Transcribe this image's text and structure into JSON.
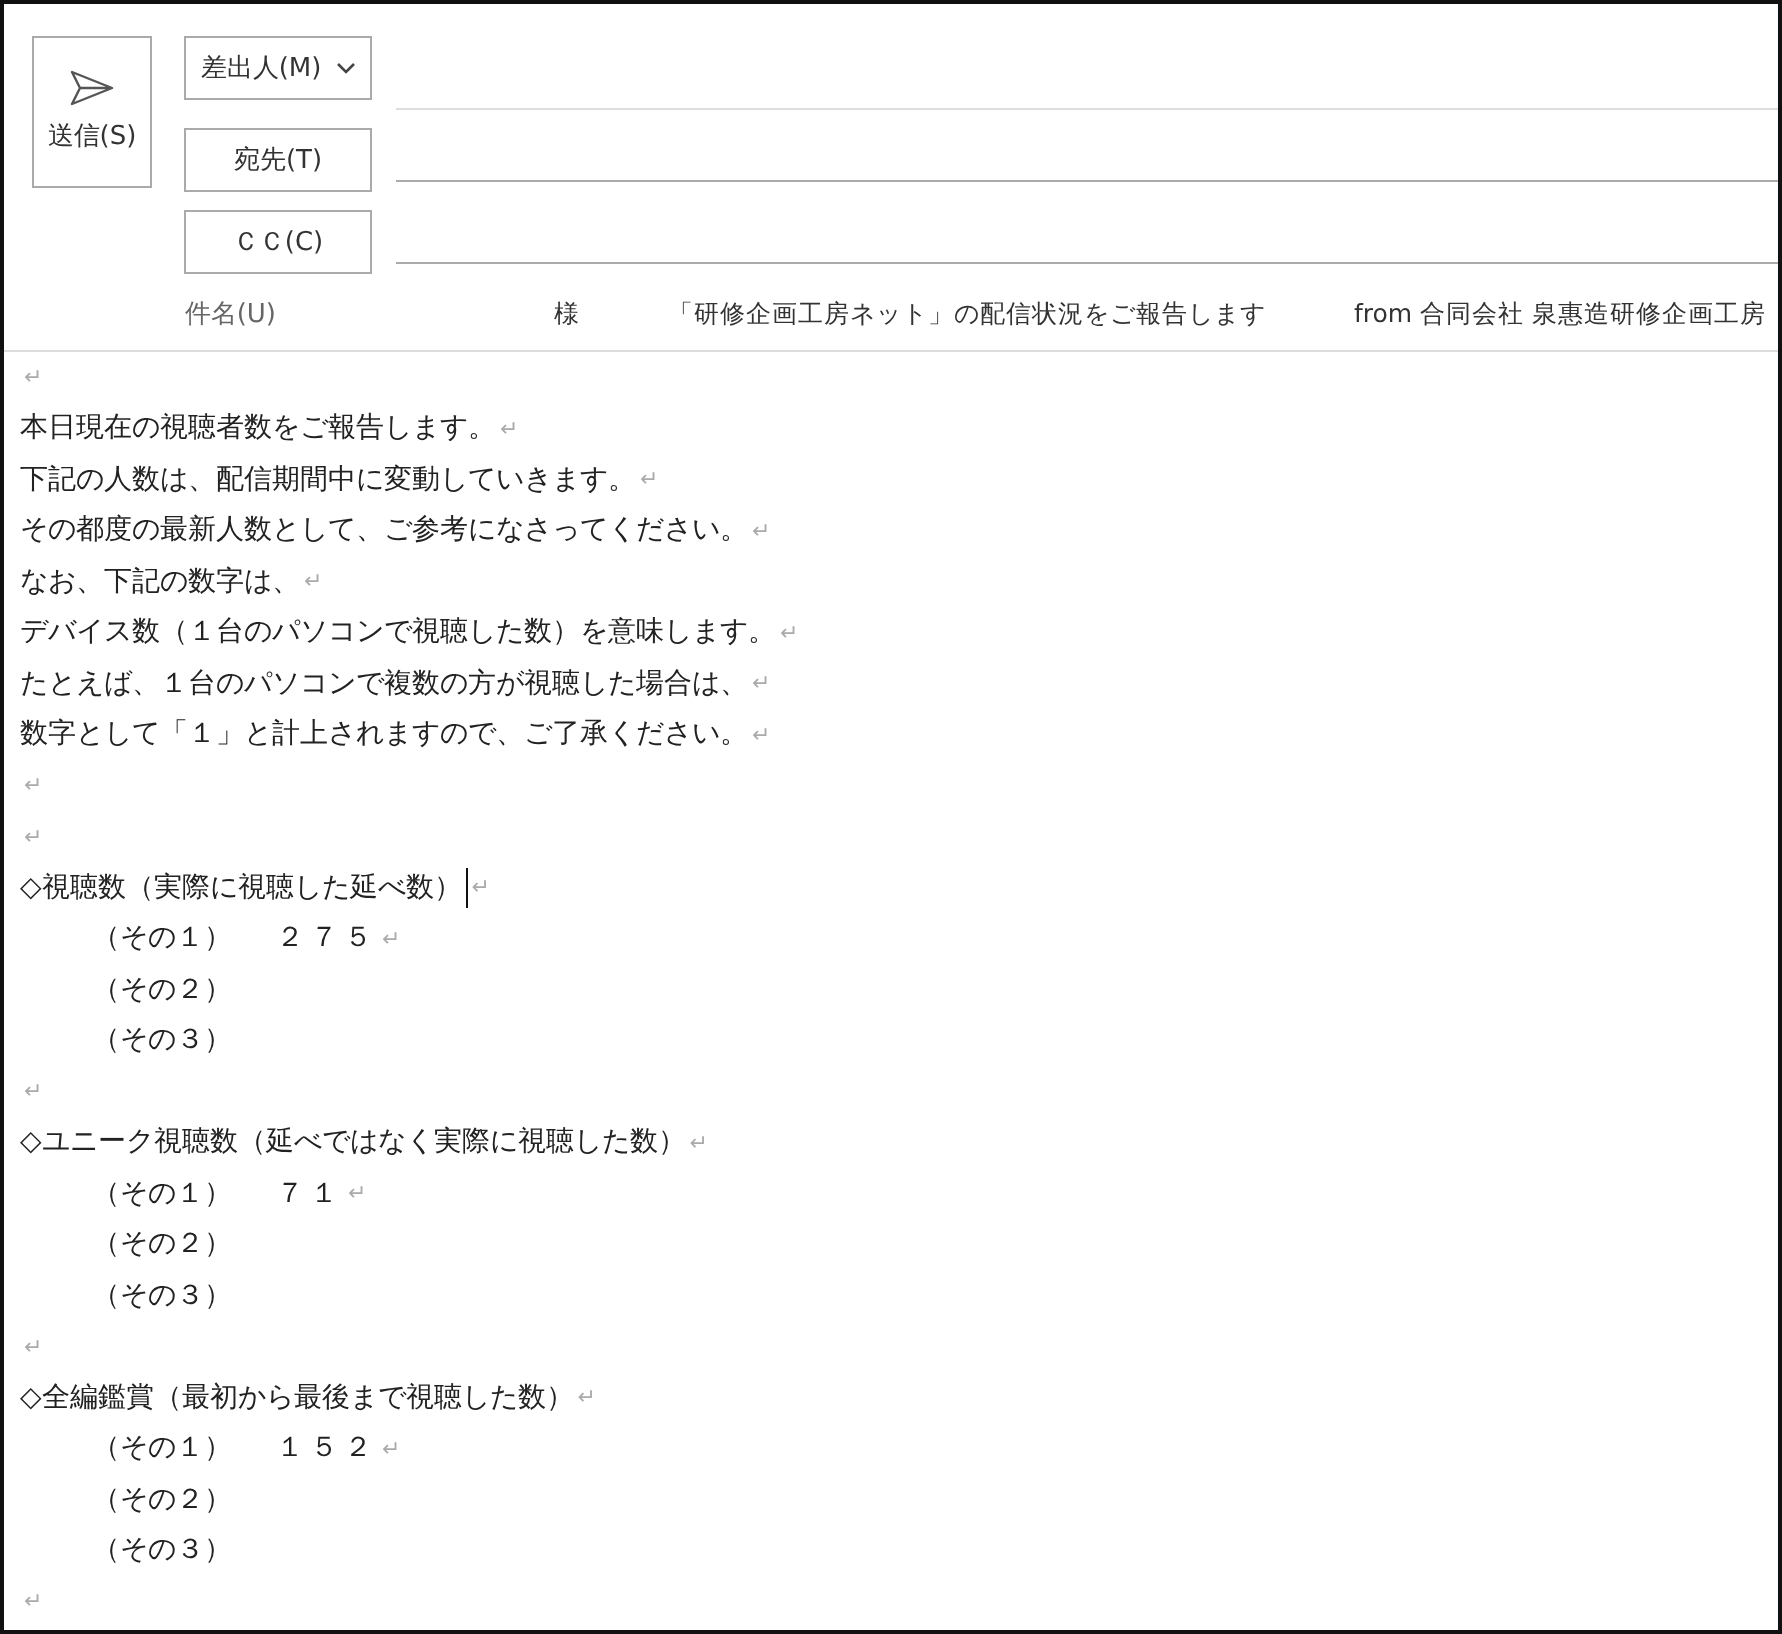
{
  "send_button": {
    "label": "送信(S)"
  },
  "address_fields": [
    {
      "label": "差出人(M)",
      "dropdown": true,
      "value_line": false
    },
    {
      "label": "宛先(T)",
      "dropdown": false,
      "value_line": true
    },
    {
      "label": "ＣＣ(C)",
      "dropdown": false,
      "value_line": true
    }
  ],
  "subject": {
    "label": "件名(U)",
    "parts": [
      "様",
      "「研修企画工房ネット」の配信状況をご報告します",
      "from 合同会社 泉惠造研修企画工房"
    ]
  },
  "body": [
    {
      "kind": "blank",
      "mark": "↵"
    },
    {
      "kind": "text",
      "text": "本日現在の視聴者数をご報告します。",
      "mark": "↵"
    },
    {
      "kind": "text",
      "text": "下記の人数は、配信期間中に変動していきます。",
      "mark": "↵"
    },
    {
      "kind": "text",
      "text": "その都度の最新人数として、ご参考になさってください。",
      "mark": "↵"
    },
    {
      "kind": "text",
      "text": "なお、下記の数字は、",
      "mark": "↵"
    },
    {
      "kind": "text",
      "text": "デバイス数（１台のパソコンで視聴した数）を意味します。",
      "mark": "↵"
    },
    {
      "kind": "text",
      "text": "たとえば、１台のパソコンで複数の方が視聴した場合は、",
      "mark": "↵"
    },
    {
      "kind": "text",
      "text": "数字として「１」と計上されますので、ご了承ください。",
      "mark": "↵"
    },
    {
      "kind": "blank",
      "mark": "↵"
    },
    {
      "kind": "blank",
      "mark": "↵"
    },
    {
      "kind": "text",
      "text": "◇視聴数（実際に視聴した延べ数）",
      "mark": "↵",
      "cursor": true
    },
    {
      "kind": "item",
      "text": "（その１）",
      "value": "２７５",
      "mark": "↵"
    },
    {
      "kind": "item",
      "text": "（その２）"
    },
    {
      "kind": "item",
      "text": "（その３）"
    },
    {
      "kind": "blank",
      "mark": "↵"
    },
    {
      "kind": "text",
      "text": "◇ユニーク視聴数（延べではなく実際に視聴した数）",
      "mark": "↵"
    },
    {
      "kind": "item",
      "text": "（その１）",
      "value": "７１",
      "mark": "↵"
    },
    {
      "kind": "item",
      "text": "（その２）"
    },
    {
      "kind": "item",
      "text": "（その３）"
    },
    {
      "kind": "blank",
      "mark": "↵"
    },
    {
      "kind": "text",
      "text": "◇全編鑑賞（最初から最後まで視聴した数）",
      "mark": "↵"
    },
    {
      "kind": "item",
      "text": "（その１）",
      "value": "１５２",
      "mark": "↵"
    },
    {
      "kind": "item",
      "text": "（その２）"
    },
    {
      "kind": "item",
      "text": "（その３）"
    },
    {
      "kind": "blank",
      "mark": "↵"
    }
  ]
}
